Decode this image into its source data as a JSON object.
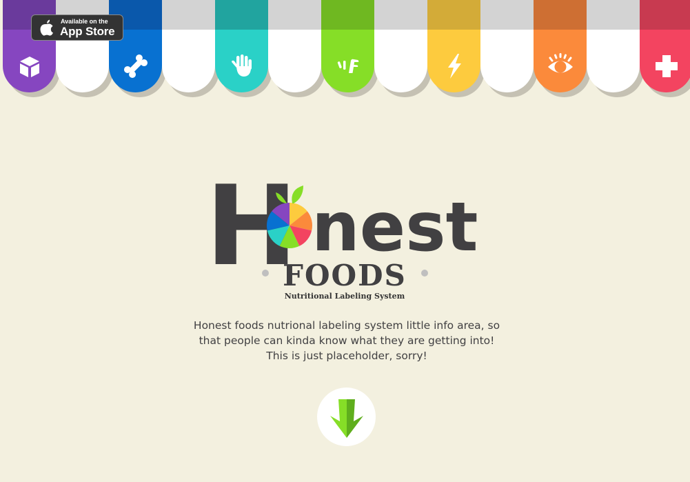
{
  "colors": {
    "background": "#f3f0df",
    "text": "#414042",
    "shadow": "#c5c1b3",
    "white_strip": "#ffffff",
    "white_strip_band": "#d3d3d3"
  },
  "awning": {
    "categories": [
      {
        "name": "packaging",
        "icon": "box-icon",
        "color": "#8646c0",
        "band": "#6a3a9c"
      },
      {
        "name": "bone",
        "icon": "bone-icon",
        "color": "#0871d1",
        "band": "#0a58ab"
      },
      {
        "name": "hand",
        "icon": "hand-icon",
        "color": "#2ad1c7",
        "band": "#21a49f"
      },
      {
        "name": "gluten",
        "icon": "grain-icon",
        "color": "#86de27",
        "band": "#6fb821"
      },
      {
        "name": "energy",
        "icon": "lightning-icon",
        "color": "#fdcb3e",
        "band": "#d3ab38"
      },
      {
        "name": "vision",
        "icon": "eye-icon",
        "color": "#fb8a3b",
        "band": "#ce6f33"
      },
      {
        "name": "health",
        "icon": "cross-icon",
        "color": "#f34460",
        "band": "#c83a50"
      }
    ]
  },
  "app_store": {
    "small_text": "Available on the",
    "big_text": "App Store",
    "icon": "apple-icon"
  },
  "logo": {
    "title_left": "H",
    "title_right": "nest",
    "foods": "FOODS",
    "subtitle": "Nutritional Labeling System",
    "wheel_colors": [
      "#fdcb3e",
      "#fb8a3b",
      "#f34460",
      "#86de27",
      "#2ad1c7",
      "#0871d1",
      "#8646c0"
    ],
    "leaf_color": "#86de27"
  },
  "description": {
    "line1": "Honest foods nutrional labeling system little info area, so",
    "line2": "that people can kinda know what they are getting into!",
    "line3": "This is just placeholder, sorry!"
  },
  "scroll_button": {
    "icon": "arrow-down-icon",
    "color_light": "#86de27",
    "color_dark": "#5fae1d"
  }
}
